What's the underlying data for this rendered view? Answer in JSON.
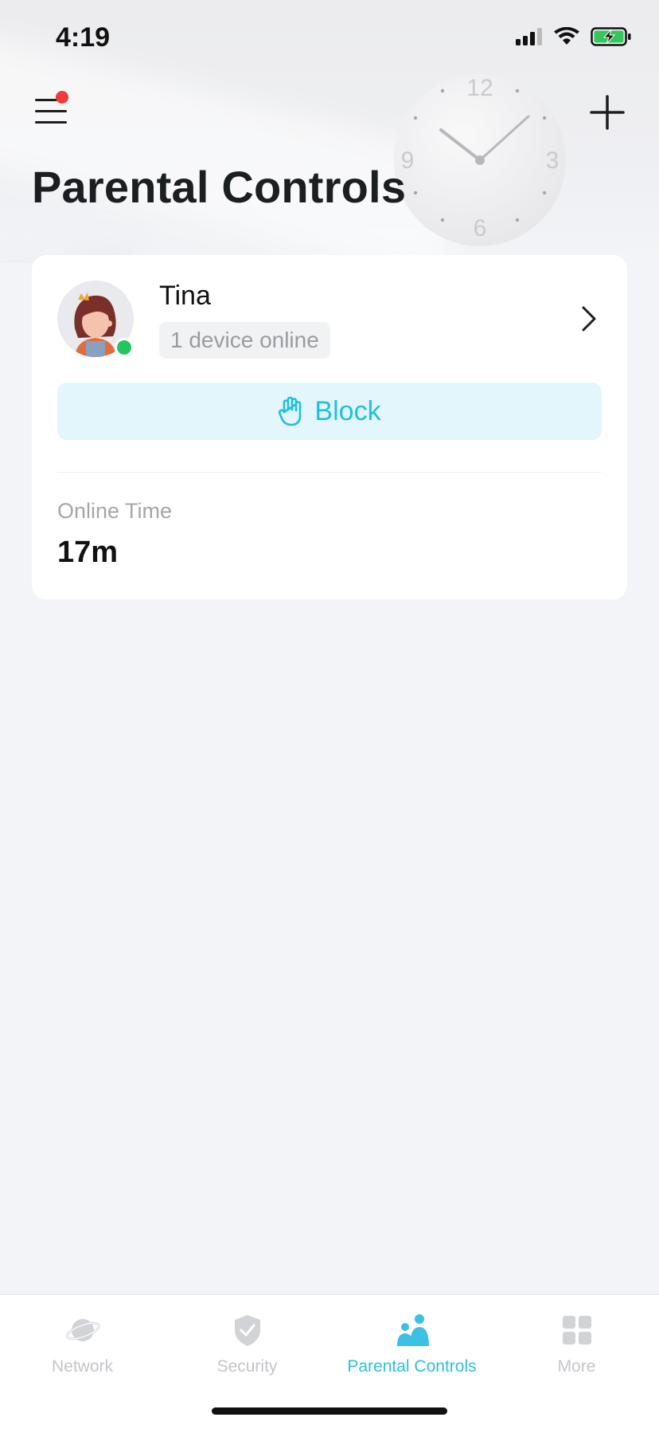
{
  "status_bar": {
    "time": "4:19"
  },
  "header": {
    "title": "Parental Controls",
    "menu_icon": "hamburger-menu-icon",
    "notification_dot": true,
    "add_icon": "plus-icon"
  },
  "profile_card": {
    "name": "Tina",
    "device_status": "1 device online",
    "online": true,
    "block_label": "Block",
    "online_time_label": "Online Time",
    "online_time_value": "17m"
  },
  "clock": {
    "numbers": [
      "12",
      "3",
      "6",
      "9"
    ]
  },
  "tabs": [
    {
      "label": "Network",
      "icon": "planet-icon",
      "active": false
    },
    {
      "label": "Security",
      "icon": "shield-check-icon",
      "active": false
    },
    {
      "label": "Parental Controls",
      "icon": "family-icon",
      "active": true
    },
    {
      "label": "More",
      "icon": "grid-icon",
      "active": false
    }
  ],
  "colors": {
    "accent": "#21c0dc",
    "block_bg": "#e3f6fb",
    "online_green": "#23c55e",
    "notification_red": "#f23a3a"
  }
}
